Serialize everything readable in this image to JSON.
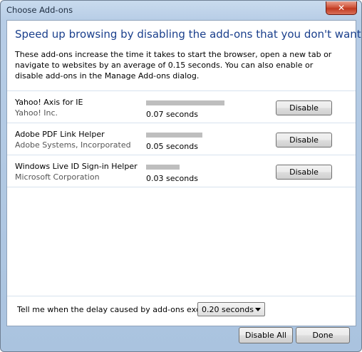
{
  "window": {
    "title": "Choose Add-ons",
    "close_label": "✕"
  },
  "main": {
    "heading": "Speed up browsing by disabling the add-ons that you don't want",
    "description": "These add-ons increase the time it takes to start the browser, open a new tab or navigate to websites by an average of 0.15 seconds. You can also enable or disable add-ons in the Manage Add-ons dialog."
  },
  "addons": [
    {
      "name": "Yahoo! Axis for IE",
      "publisher": "Yahoo! Inc.",
      "delay": "0.07 seconds",
      "delay_seconds": 0.07,
      "button": "Disable"
    },
    {
      "name": "Adobe PDF Link Helper",
      "publisher": "Adobe Systems, Incorporated",
      "delay": "0.05 seconds",
      "delay_seconds": 0.05,
      "button": "Disable"
    },
    {
      "name": "Windows Live ID Sign-in Helper",
      "publisher": "Microsoft Corporation",
      "delay": "0.03 seconds",
      "delay_seconds": 0.03,
      "button": "Disable"
    }
  ],
  "footer": {
    "threshold_label": "Tell me when the delay caused by add-ons exceeds:",
    "threshold_value": "0.20 seconds",
    "disable_all": "Disable All",
    "done": "Done"
  },
  "colors": {
    "heading": "#1a3f8c",
    "delay_bar": "#bebebe",
    "close_button": "#c03a20"
  }
}
